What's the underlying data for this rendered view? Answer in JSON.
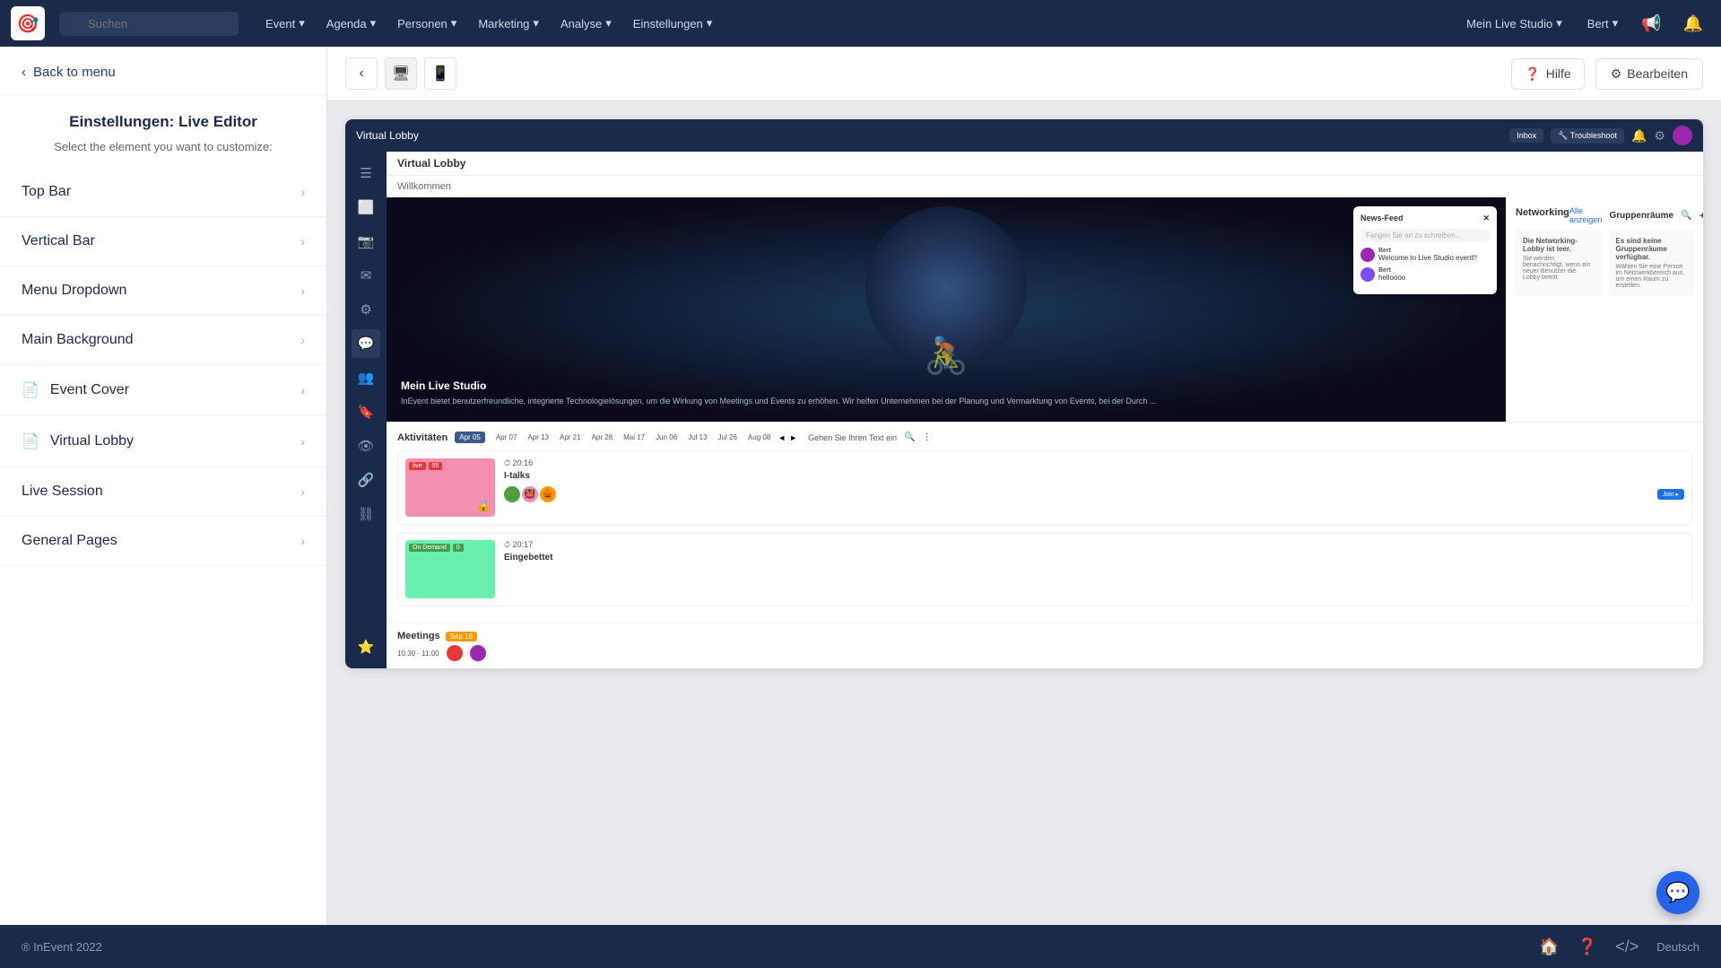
{
  "topnav": {
    "logo": "🎯",
    "search_placeholder": "Suchen",
    "nav_items": [
      {
        "label": "Event",
        "has_dropdown": true
      },
      {
        "label": "Agenda",
        "has_dropdown": true
      },
      {
        "label": "Personen",
        "has_dropdown": true
      },
      {
        "label": "Marketing",
        "has_dropdown": true
      },
      {
        "label": "Analyse",
        "has_dropdown": true
      },
      {
        "label": "Einstellungen",
        "has_dropdown": true
      }
    ],
    "right_items": [
      {
        "label": "Mein Live Studio",
        "has_dropdown": true
      },
      {
        "label": "Bert",
        "has_dropdown": true
      }
    ]
  },
  "sidebar": {
    "back_btn": "Back to menu",
    "title": "Einstellungen: Live Editor",
    "subtitle": "Select the element you want to customize:",
    "menu_items": [
      {
        "label": "Top Bar",
        "has_icon": false
      },
      {
        "label": "Vertical Bar",
        "has_icon": false
      },
      {
        "label": "Menu Dropdown",
        "has_icon": false
      },
      {
        "label": "Main Background",
        "has_icon": false
      },
      {
        "label": "Event Cover",
        "has_icon": true
      },
      {
        "label": "Virtual Lobby",
        "has_icon": true
      },
      {
        "label": "Live Session",
        "has_icon": false
      },
      {
        "label": "General Pages",
        "has_icon": false
      }
    ]
  },
  "preview": {
    "help_btn": "Hilfe",
    "edit_btn": "Bearbeiten",
    "frame": {
      "topbar_title": "Virtual Lobby",
      "welcome": "Willkommen",
      "event_title": "Mein Live Studio",
      "event_desc": "InEvent bietet benutzerfreundliche, integrierte Technologielösungen, um die Wirkung von Meetings und Events zu erhöhen. Wir helfen Unternehmen bei der Planung und Vermarktung von Events, bei der Durch ...",
      "newsfeed_title": "News-Feed",
      "newsfeed_placeholder": "Fangen Sie an zu schreiben...",
      "msg1_name": "Bert",
      "msg1_text": "Welcome to Live Studio event!!",
      "msg2_name": "Bert",
      "msg2_text": "helloooo",
      "networking_title": "Networking",
      "networking_link": "Alle anzeigen",
      "networking_rooms": "Gruppenräume",
      "activity_title": "Aktivitäten",
      "activity_date": "Apr 05",
      "dates": [
        "Apr 07",
        "Apr 13",
        "Apr 21",
        "Apr 28",
        "Mai 17",
        "Jun 06",
        "Jul 13",
        "Jul 26",
        "Aug 08"
      ],
      "activity1_tag": "live",
      "activity1_tag2": "05",
      "activity1_time": "20:16",
      "activity1_name": "I-talks",
      "activity2_tag": "On Demand",
      "activity2_tag2": "0",
      "activity2_time": "20:17",
      "activity2_name": "Eingebettet",
      "meetings_title": "Meetings",
      "meetings_date": "Sep 16",
      "meeting_time": "10:30 - 11:00"
    }
  },
  "bottombar": {
    "copyright": "® InEvent 2022",
    "lang": "Deutsch"
  }
}
